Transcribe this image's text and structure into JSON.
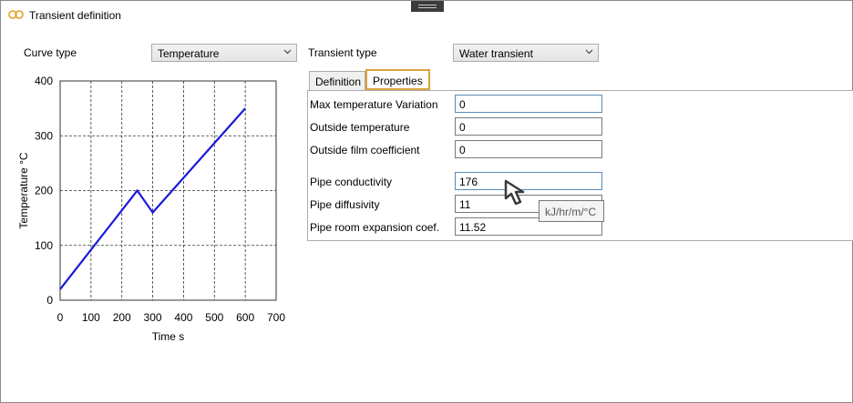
{
  "window": {
    "title": "Transient definition"
  },
  "curve_type": {
    "label": "Curve type",
    "value": "Temperature"
  },
  "transient_type": {
    "label": "Transient type",
    "value": "Water transient"
  },
  "tabs": [
    {
      "label": "Definition",
      "active": false
    },
    {
      "label": "Properties",
      "active": true
    }
  ],
  "properties": [
    {
      "label": "Max temperature Variation",
      "value": "0"
    },
    {
      "label": "Outside temperature",
      "value": "0"
    },
    {
      "label": "Outside film coefficient",
      "value": "0"
    },
    {
      "label": "Pipe conductivity",
      "value": "176"
    },
    {
      "label": "Pipe diffusivity",
      "value": "11"
    },
    {
      "label": "Pipe room expansion coef.",
      "value": "11.52"
    }
  ],
  "tooltip": {
    "text": "kJ/hr/m/°C"
  },
  "colors": {
    "curve": "#1a1adb",
    "highlight": "#d8a23a"
  },
  "chart_data": {
    "type": "line",
    "xlabel": "Time s",
    "ylabel": "Temperature  °C",
    "xlim": [
      0,
      700
    ],
    "ylim": [
      0,
      400
    ],
    "xticks": [
      "0",
      "100",
      "200",
      "300",
      "400",
      "500",
      "600",
      "700"
    ],
    "yticks": [
      "0",
      "100",
      "200",
      "300",
      "400"
    ],
    "grid": true,
    "series": [
      {
        "x": [
          0,
          250,
          300,
          600
        ],
        "y": [
          20,
          200,
          160,
          350
        ]
      }
    ]
  }
}
